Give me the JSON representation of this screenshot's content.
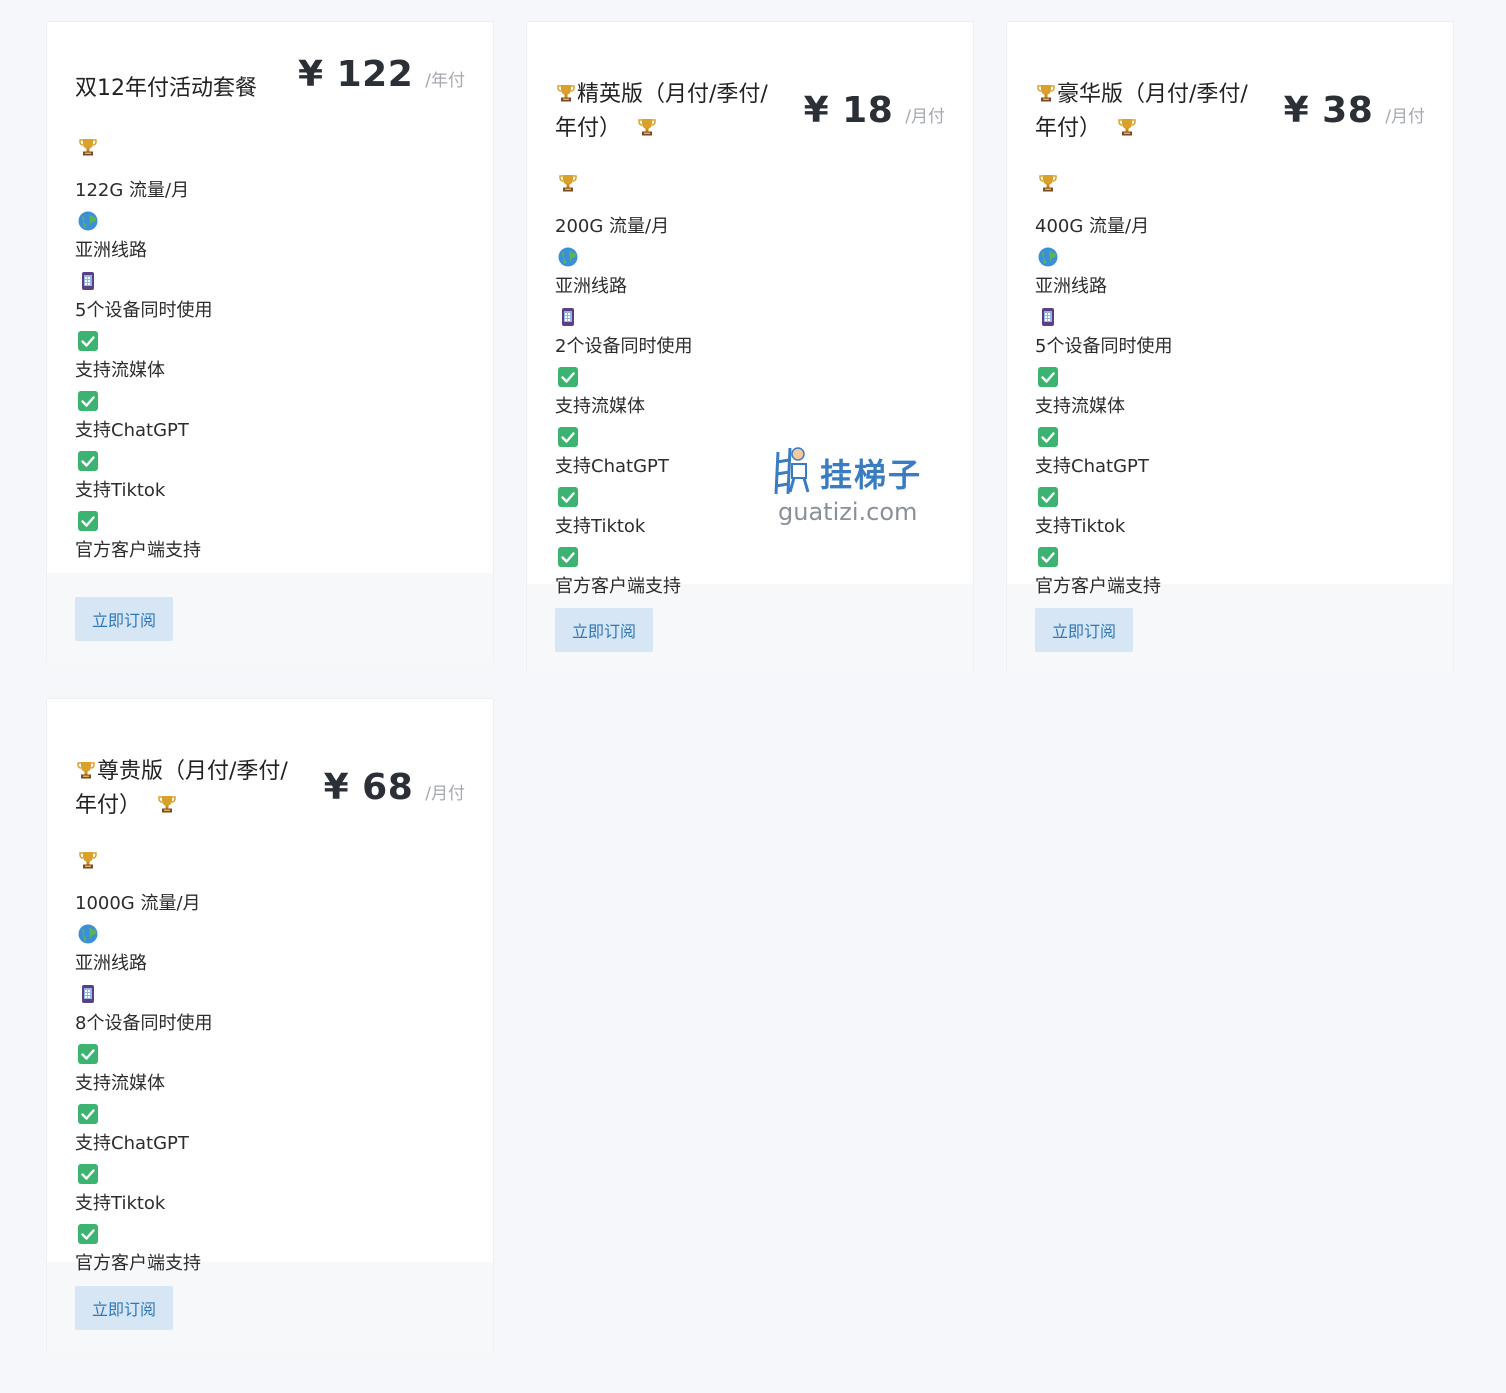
{
  "plans": [
    {
      "title": "双12年付活动套餐",
      "price": "¥ 122",
      "period": "/年付",
      "traffic": "122G 流量/月",
      "route": "亚洲线路",
      "devices": "5个设备同时使用",
      "streaming": "支持流媒体",
      "chatgpt": "支持ChatGPT",
      "tiktok": "支持Tiktok",
      "client": "官方客户端支持",
      "button": "立即订阅"
    },
    {
      "title_prefix": "精英版（月付/季付/年付）",
      "price": "¥ 18",
      "period": "/月付",
      "traffic": "200G 流量/月",
      "route": "亚洲线路",
      "devices": "2个设备同时使用",
      "streaming": "支持流媒体",
      "chatgpt": "支持ChatGPT",
      "tiktok": "支持Tiktok",
      "client": "官方客户端支持",
      "button": "立即订阅"
    },
    {
      "title_prefix": "豪华版（月付/季付/年付）",
      "price": "¥ 38",
      "period": "/月付",
      "traffic": "400G 流量/月",
      "route": "亚洲线路",
      "devices": "5个设备同时使用",
      "streaming": "支持流媒体",
      "chatgpt": "支持ChatGPT",
      "tiktok": "支持Tiktok",
      "client": "官方客户端支持",
      "button": "立即订阅"
    },
    {
      "title_prefix": "尊贵版（月付/季付/年付）",
      "price": "¥ 68",
      "period": "/月付",
      "traffic": "1000G 流量/月",
      "route": "亚洲线路",
      "devices": "8个设备同时使用",
      "streaming": "支持流媒体",
      "chatgpt": "支持ChatGPT",
      "tiktok": "支持Tiktok",
      "client": "官方客户端支持",
      "button": "立即订阅"
    }
  ],
  "watermark": {
    "title": "挂梯子",
    "url": "guatizi.com"
  },
  "colors": {
    "accent": "#2f78b7",
    "button_bg": "#d6e6f5",
    "check": "#3cb371",
    "page_bg": "#f5f7fa"
  },
  "icons": [
    "trophy-icon",
    "globe-icon",
    "phone-icon",
    "check-icon"
  ]
}
